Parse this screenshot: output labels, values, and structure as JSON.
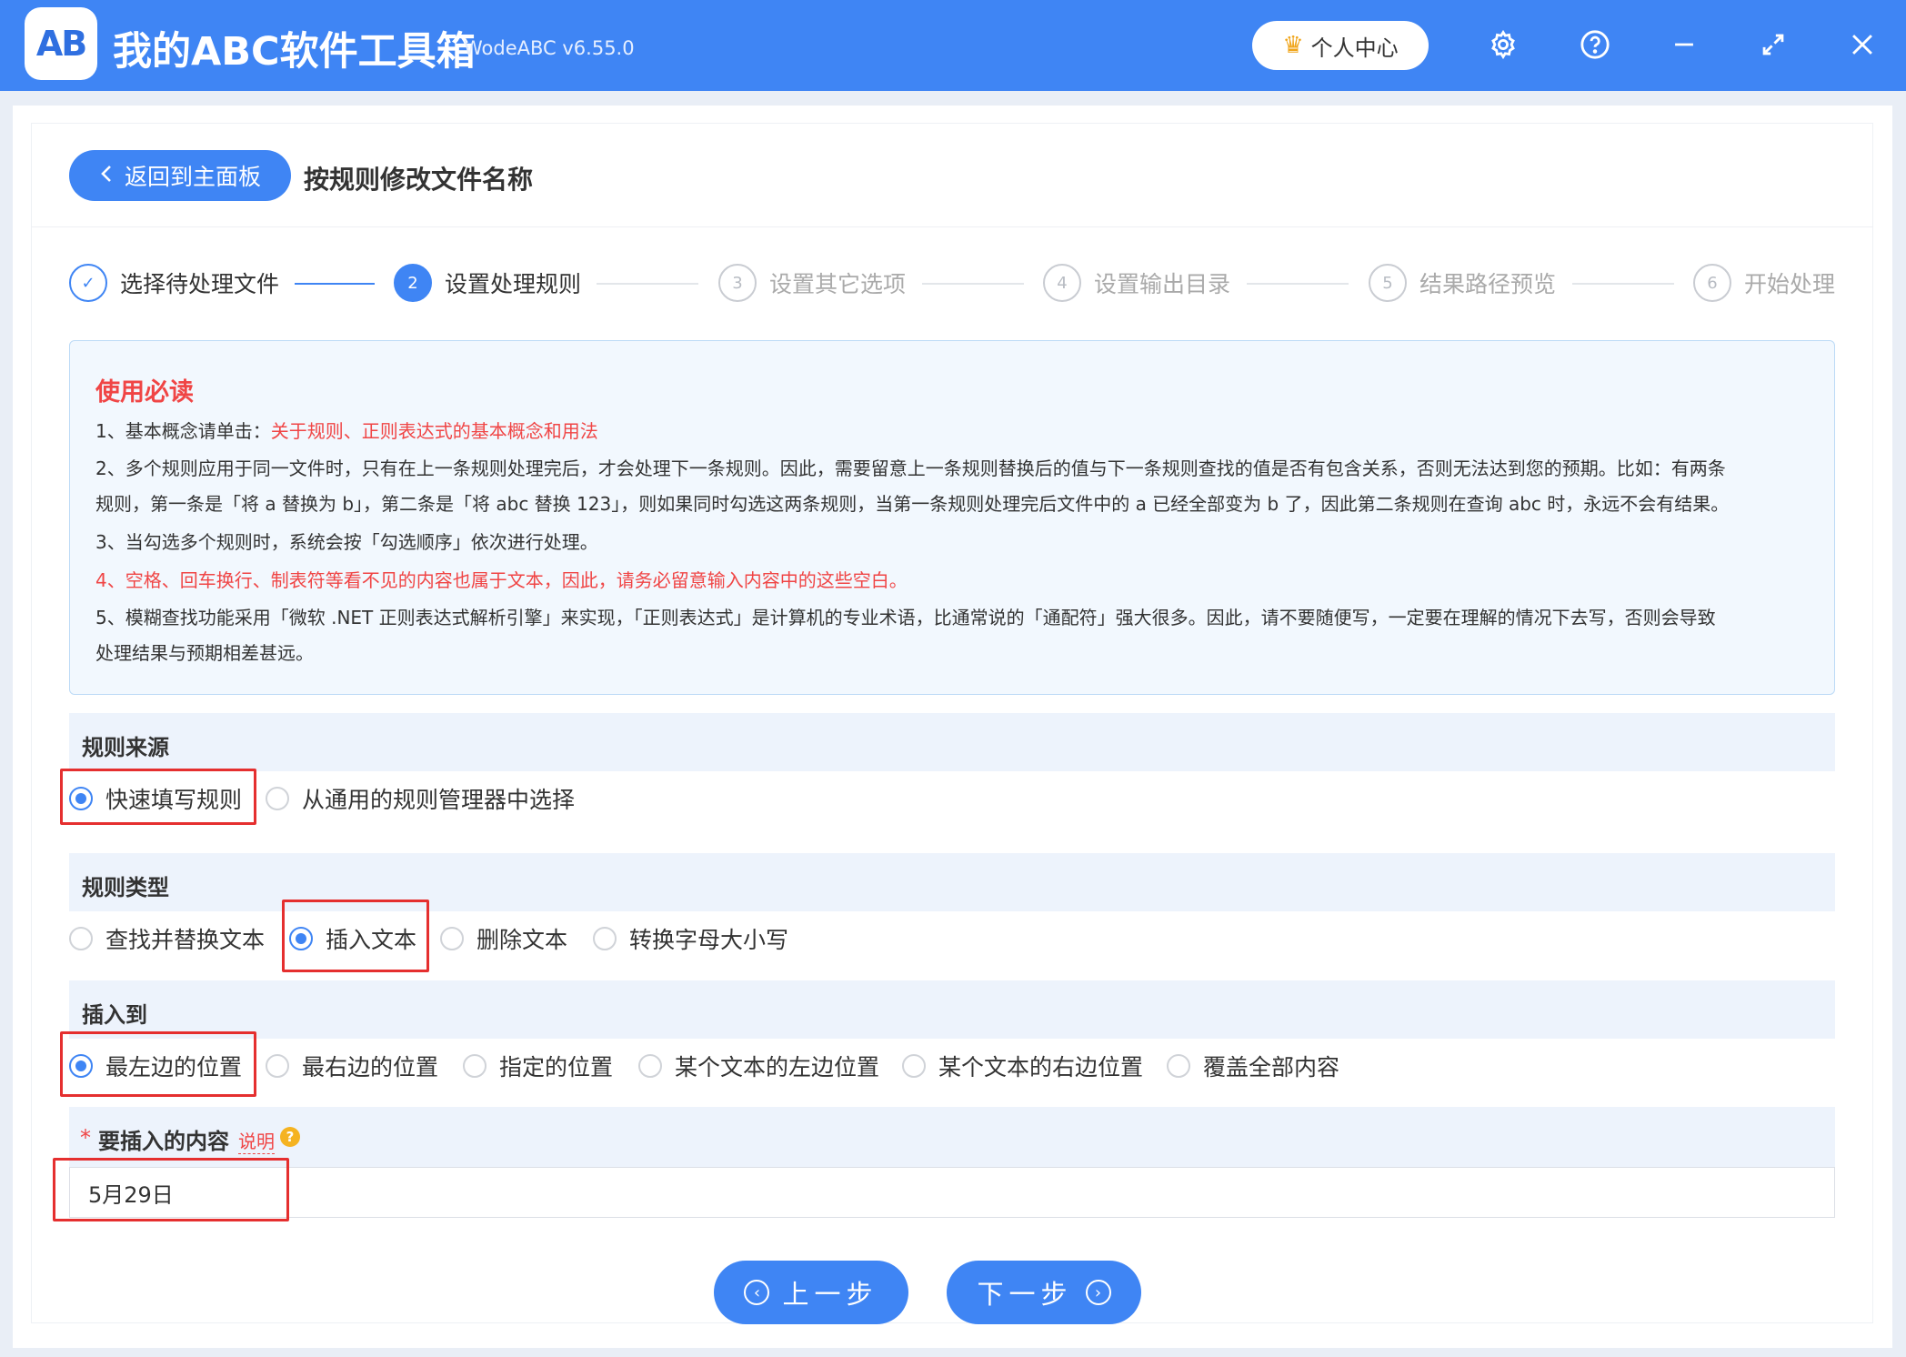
{
  "app": {
    "logo_text": "AB",
    "title": "我的ABC软件工具箱",
    "version": "WodeABC v6.55.0",
    "user_center": "个人中心"
  },
  "header": {
    "back_label": "返回到主面板",
    "page_title": "按规则修改文件名称"
  },
  "steps": [
    {
      "num": "✓",
      "label": "选择待处理文件",
      "state": "done"
    },
    {
      "num": "2",
      "label": "设置处理规则",
      "state": "active"
    },
    {
      "num": "3",
      "label": "设置其它选项",
      "state": "pending"
    },
    {
      "num": "4",
      "label": "设置输出目录",
      "state": "pending"
    },
    {
      "num": "5",
      "label": "结果路径预览",
      "state": "pending"
    },
    {
      "num": "6",
      "label": "开始处理",
      "state": "pending"
    }
  ],
  "notice": {
    "title": "使用必读",
    "line1_prefix": "1、基本概念请单击：",
    "line1_link": "关于规则、正则表达式的基本概念和用法",
    "line2a": "2、多个规则应用于同一文件时，只有在上一条规则处理完后，才会处理下一条规则。因此，需要留意上一条规则替换后的值与下一条规则查找的值是否有包含关系，否则无法达到您的预期。比如：有两条",
    "line2b": "规则，第一条是「将 a 替换为 b」，第二条是「将 abc 替换 123」，则如果同时勾选这两条规则，当第一条规则处理完后文件中的 a 已经全部变为 b 了，因此第二条规则在查询 abc 时，永远不会有结果。",
    "line3": "3、当勾选多个规则时，系统会按「勾选顺序」依次进行处理。",
    "line4": "4、空格、回车换行、制表符等看不见的内容也属于文本，因此，请务必留意输入内容中的这些空白。",
    "line5a": "5、模糊查找功能采用「微软 .NET 正则表达式解析引擎」来实现，「正则表达式」是计算机的专业术语，比通常说的「通配符」强大很多。因此，请不要随便写，一定要在理解的情况下去写，否则会导致",
    "line5b": "处理结果与预期相差甚远。"
  },
  "rule_source": {
    "title": "规则来源",
    "options": [
      "快速填写规则",
      "从通用的规则管理器中选择"
    ],
    "selected": "快速填写规则"
  },
  "rule_type": {
    "title": "规则类型",
    "options": [
      "查找并替换文本",
      "插入文本",
      "删除文本",
      "转换字母大小写"
    ],
    "selected": "插入文本"
  },
  "insert_to": {
    "title": "插入到",
    "options": [
      "最左边的位置",
      "最右边的位置",
      "指定的位置",
      "某个文本的左边位置",
      "某个文本的右边位置",
      "覆盖全部内容"
    ],
    "selected": "最左边的位置"
  },
  "insert_content": {
    "required_mark": "*",
    "label": "要插入的内容",
    "help": "说明",
    "help_icon": "?",
    "value": "5月29日"
  },
  "nav": {
    "prev": "上一步",
    "next": "下一步"
  },
  "colors": {
    "accent": "#3f85f4",
    "highlight": "#e52f2f",
    "warning": "#f04545"
  }
}
